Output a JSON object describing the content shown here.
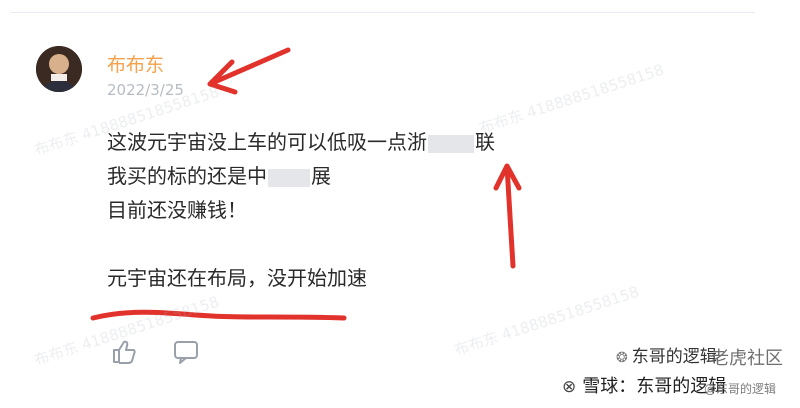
{
  "post": {
    "author": "布布东",
    "date": "2022/3/25",
    "lines": [
      {
        "before": "这波元宇宙没上车的可以低吸一点浙",
        "after": "联"
      },
      {
        "before": "我买的标的还是中",
        "after": "展"
      },
      {
        "before": "目前还没赚钱！",
        "after": ""
      },
      {
        "before": "元宇宙还在布局，没开始加速",
        "after": ""
      }
    ]
  },
  "watermark": {
    "text": "布布东 418888518558158"
  },
  "branding": {
    "wechat": "东哥的逻辑",
    "community": "老虎社区",
    "xueqiu": "雪球：东哥的逻辑",
    "small": "@东哥的逻辑"
  },
  "colors": {
    "author": "#f5a04a",
    "date": "#b7bcc3",
    "arrow": "#e1322b",
    "underline": "#e1322b"
  },
  "icons": {
    "like": "thumbs-up-icon",
    "comment": "comment-icon"
  }
}
